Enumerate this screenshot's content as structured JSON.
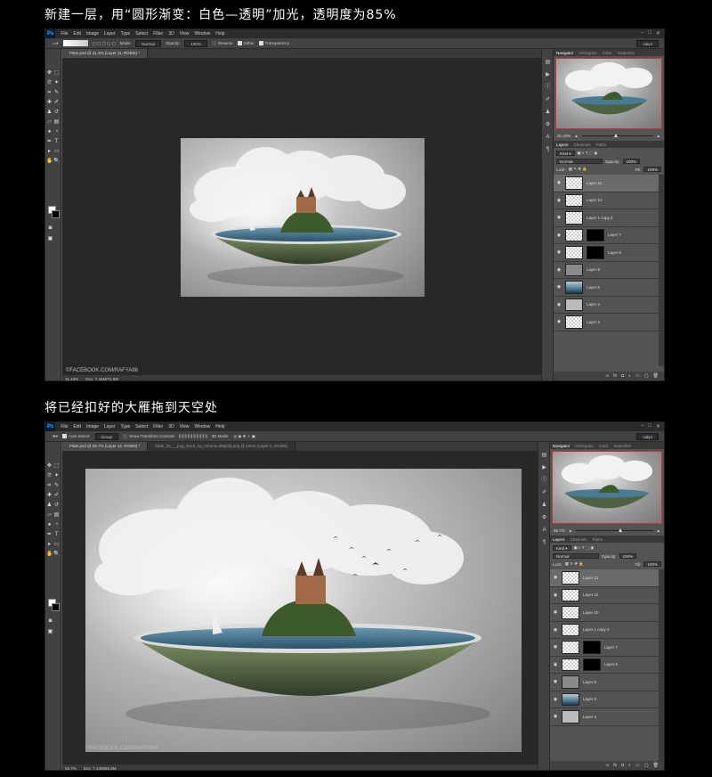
{
  "captions": {
    "top": "新建一层，用“圆形渐变：白色—透明”加光，透明度为85%",
    "bottom": "将已经扣好的大雁拖到天空处"
  },
  "menu": [
    "File",
    "Edit",
    "Image",
    "Layer",
    "Type",
    "Select",
    "Filter",
    "3D",
    "View",
    "Window",
    "Help"
  ],
  "app_logo": "Ps",
  "screen1": {
    "options": {
      "mode_label": "Mode:",
      "mode_value": "Normal",
      "opacity_label": "Opacity:",
      "opacity_value": "100%",
      "reverse": "Reverse",
      "dither": "Dither",
      "transparency": "Transparency",
      "workspace": "caly4"
    },
    "doc_tab": "Plate.psd @ 31.4% (Layer 11, RGB/8) *",
    "status_zoom": "31.44%",
    "status_doc": "Doc: 7.44M/71.5M",
    "watermark": "©FACEBOOK.COM/RAFYA88",
    "panel_tabs": [
      "Navigator",
      "Histogram",
      "Color",
      "Swatches"
    ],
    "nav_zoom": "31.44%",
    "layer_tabs": [
      "Layers",
      "Channels",
      "Paths"
    ],
    "kind_label": "Kind",
    "blend_mode": "Normal",
    "opacity_label": "Opacity:",
    "opacity_value": "100%",
    "lock_label": "Lock:",
    "fill_label": "Fill:",
    "fill_value": "100%",
    "layers": [
      {
        "name": "Layer 11",
        "thumb": "trans",
        "mask": false,
        "selected": true
      },
      {
        "name": "Layer 10",
        "thumb": "trans",
        "mask": false,
        "selected": false
      },
      {
        "name": "Layer 1 copy 2",
        "thumb": "trans",
        "mask": false,
        "selected": false
      },
      {
        "name": "Layer 7",
        "thumb": "trans",
        "mask": true,
        "selected": false
      },
      {
        "name": "Layer 6",
        "thumb": "trans",
        "mask": true,
        "selected": false
      },
      {
        "name": "Layer 8",
        "thumb": "gray",
        "mask": false,
        "selected": false
      },
      {
        "name": "Layer 5",
        "thumb": "water",
        "mask": false,
        "selected": false
      },
      {
        "name": "Layer 4",
        "thumb": "dark",
        "mask": false,
        "selected": false
      },
      {
        "name": "Layer 2",
        "thumb": "trans",
        "mask": false,
        "selected": false
      }
    ]
  },
  "screen2": {
    "options": {
      "auto_select": "Auto-Select:",
      "group": "Group",
      "transform": "Show Transform Controls",
      "mode3d": "3D Mode:",
      "workspace": "caly4"
    },
    "doc_tab": "Plate.psd @ 55.7% (Layer 12, RGB/8) *",
    "doc_tab2": "birds_02___png_stock_by_mbonio-d9qlofd.png @ 100% (Layer 0, RGB/8)",
    "status_zoom": "55.7%",
    "status_doc": "Doc: 7.44M/86.8M",
    "watermark": "©FACEBOOK.COM/RAFYA88",
    "panel_tabs": [
      "Navigator",
      "Histogram",
      "Color",
      "Swatches"
    ],
    "nav_zoom": "55.7%",
    "layer_tabs": [
      "Layers",
      "Channels",
      "Paths"
    ],
    "kind_label": "Kind",
    "blend_mode": "Normal",
    "opacity_label": "Opacity:",
    "opacity_value": "100%",
    "lock_label": "Lock:",
    "fill_label": "Fill:",
    "fill_value": "100%",
    "layers": [
      {
        "name": "Layer 12",
        "thumb": "trans",
        "mask": false,
        "selected": true
      },
      {
        "name": "Layer 11",
        "thumb": "trans",
        "mask": false,
        "selected": false
      },
      {
        "name": "Layer 10",
        "thumb": "trans",
        "mask": false,
        "selected": false
      },
      {
        "name": "Layer 1 copy 2",
        "thumb": "trans",
        "mask": false,
        "selected": false
      },
      {
        "name": "Layer 7",
        "thumb": "trans",
        "mask": true,
        "selected": false
      },
      {
        "name": "Layer 6",
        "thumb": "trans",
        "mask": true,
        "selected": false
      },
      {
        "name": "Layer 8",
        "thumb": "gray",
        "mask": false,
        "selected": false
      },
      {
        "name": "Layer 5",
        "thumb": "water",
        "mask": false,
        "selected": false
      },
      {
        "name": "Layer 4",
        "thumb": "dark",
        "mask": false,
        "selected": false
      }
    ]
  },
  "colors": {
    "ps_blue": "#31a8ff",
    "selection_border": "#c8303a",
    "ui_dark": "#535353"
  }
}
